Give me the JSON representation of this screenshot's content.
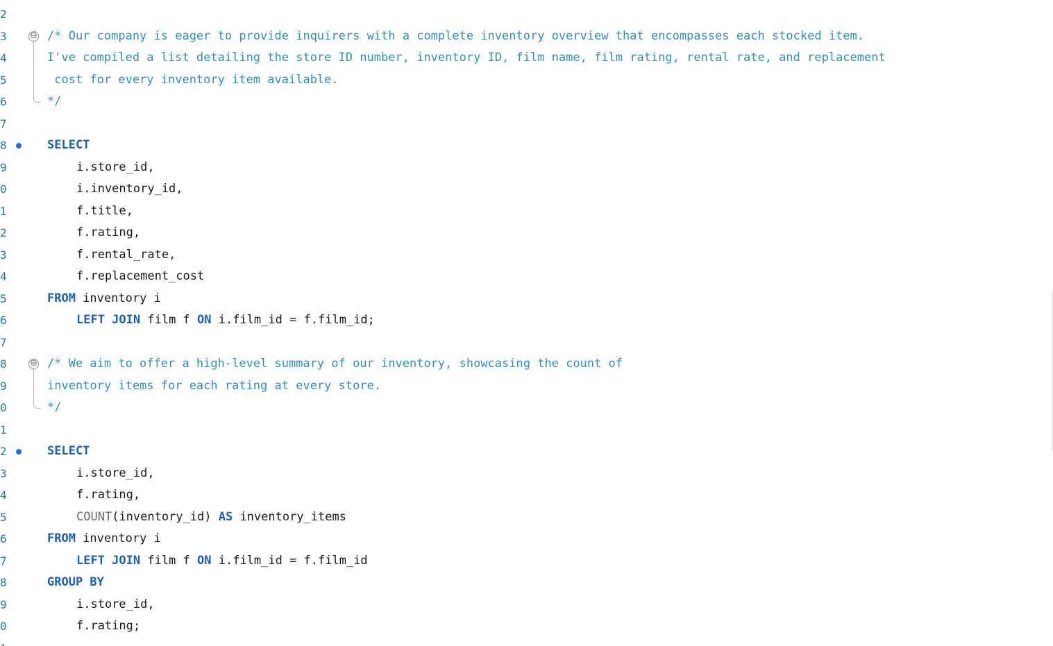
{
  "editor": {
    "lines": [
      {
        "number": "2",
        "text": ""
      },
      {
        "number": "3",
        "text": "/* Our company is eager to provide inquirers with a complete inventory overview that encompasses each stocked item."
      },
      {
        "number": "4",
        "text": "I've compiled a list detailing the store ID number, inventory ID, film name, film rating, rental rate, and replacement"
      },
      {
        "number": "5",
        "text": " cost for every inventory item available."
      },
      {
        "number": "6",
        "text": "*/"
      },
      {
        "number": "7",
        "text": ""
      },
      {
        "number": "8",
        "text": "SELECT"
      },
      {
        "number": "9",
        "text": "i.store_id,"
      },
      {
        "number": "0",
        "text": "i.inventory_id,"
      },
      {
        "number": "1",
        "text": "f.title,"
      },
      {
        "number": "2",
        "text": "f.rating,"
      },
      {
        "number": "3",
        "text": "f.rental_rate,"
      },
      {
        "number": "4",
        "text": "f.replacement_cost"
      },
      {
        "number": "5",
        "kw": "FROM",
        "rest": " inventory i"
      },
      {
        "number": "6",
        "kw1": "LEFT JOIN",
        "mid": " film f ",
        "kw2": "ON",
        "rest": " i.film_id = f.film_id;"
      },
      {
        "number": "7",
        "text": ""
      },
      {
        "number": "8",
        "text": "/* We aim to offer a high-level summary of our inventory, showcasing the count of"
      },
      {
        "number": "9",
        "text": "inventory items for each rating at every store."
      },
      {
        "number": "0",
        "text": "*/"
      },
      {
        "number": "1",
        "text": ""
      },
      {
        "number": "2",
        "text": "SELECT"
      },
      {
        "number": "3",
        "text": "i.store_id,"
      },
      {
        "number": "4",
        "text": "f.rating,"
      },
      {
        "number": "5",
        "fn": "COUNT",
        "mid": "(inventory_id) ",
        "kw": "AS",
        "rest": " inventory_items"
      },
      {
        "number": "6",
        "kw": "FROM",
        "rest": " inventory i"
      },
      {
        "number": "7",
        "kw1": "LEFT JOIN",
        "mid": " film f ",
        "kw2": "ON",
        "rest": " i.film_id = f.film_id"
      },
      {
        "number": "8",
        "text": "GROUP BY"
      },
      {
        "number": "9",
        "text": "i.store_id,"
      },
      {
        "number": "0",
        "text": "f.rating;"
      },
      {
        "number": "1",
        "text": ""
      }
    ]
  },
  "fold_glyph": "⊖",
  "colors": {
    "comment": "#2e8fb8",
    "keyword": "#1c5fb5",
    "function": "#6b6b6b",
    "line_number": "#237893",
    "marker": "#1f6fd6"
  }
}
